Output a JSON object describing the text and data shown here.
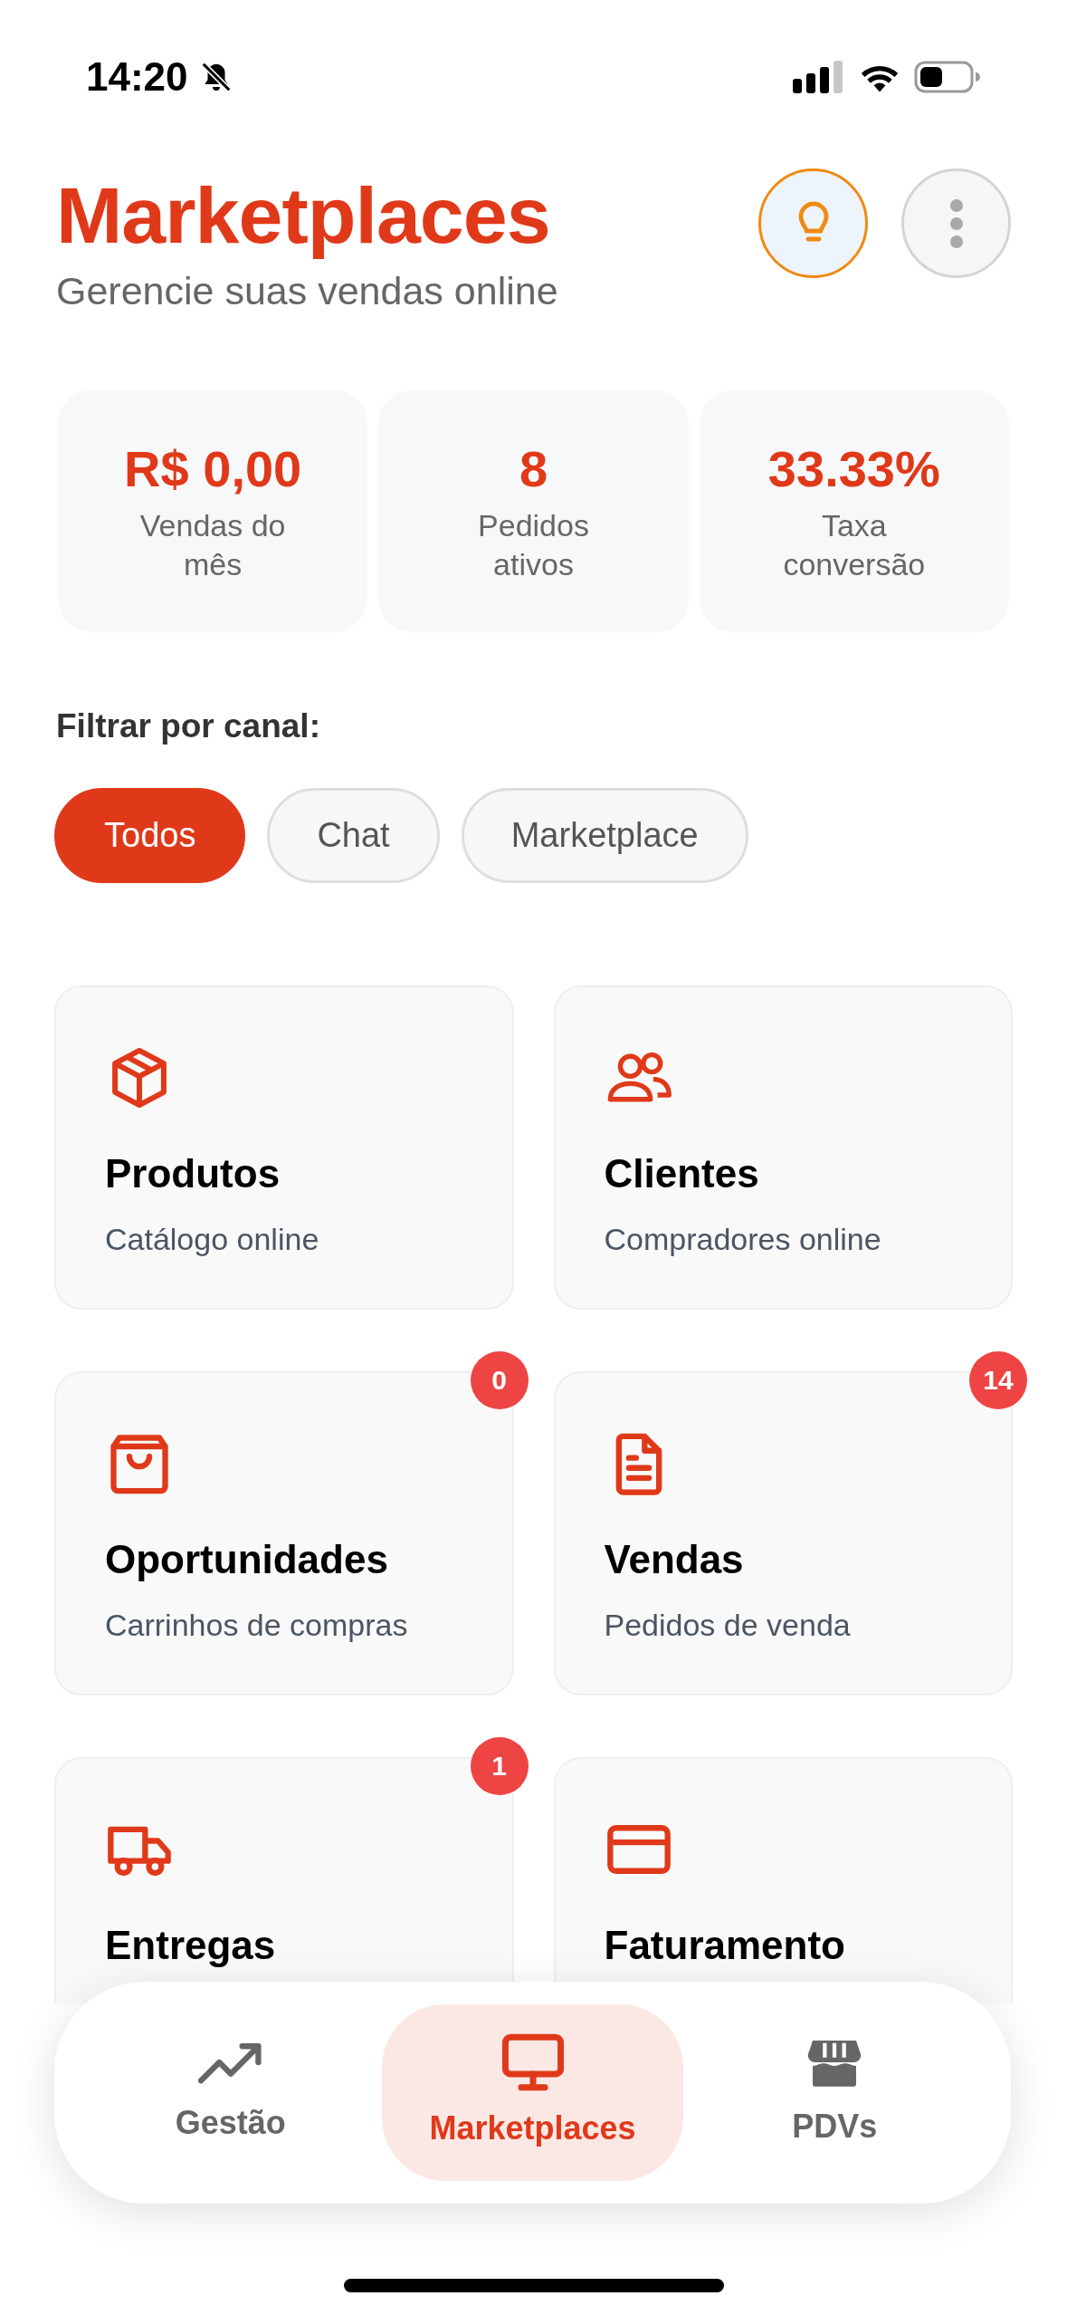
{
  "status_bar": {
    "time": "14:20"
  },
  "header": {
    "title": "Marketplaces",
    "subtitle": "Gerencie suas vendas online"
  },
  "stats": [
    {
      "value": "R$ 0,00",
      "label": "Vendas do mês"
    },
    {
      "value": "8",
      "label": "Pedidos ativos"
    },
    {
      "value": "33.33%",
      "label": "Taxa conversão"
    }
  ],
  "filter": {
    "label": "Filtrar por canal:",
    "chips": [
      {
        "label": "Todos",
        "selected": true
      },
      {
        "label": "Chat",
        "selected": false
      },
      {
        "label": "Marketplace",
        "selected": false
      }
    ]
  },
  "modules": [
    {
      "title": "Produtos",
      "subtitle": "Catálogo online"
    },
    {
      "title": "Clientes",
      "subtitle": "Compradores online"
    },
    {
      "title": "Oportunidades",
      "subtitle": "Carrinhos de compras",
      "badge": "0"
    },
    {
      "title": "Vendas",
      "subtitle": "Pedidos de venda",
      "badge": "14"
    },
    {
      "title": "Entregas",
      "badge": "1"
    },
    {
      "title": "Faturamento"
    }
  ],
  "bottom_nav": [
    {
      "label": "Gestão",
      "selected": false
    },
    {
      "label": "Marketplaces",
      "selected": true
    },
    {
      "label": "PDVs",
      "selected": false
    }
  ]
}
